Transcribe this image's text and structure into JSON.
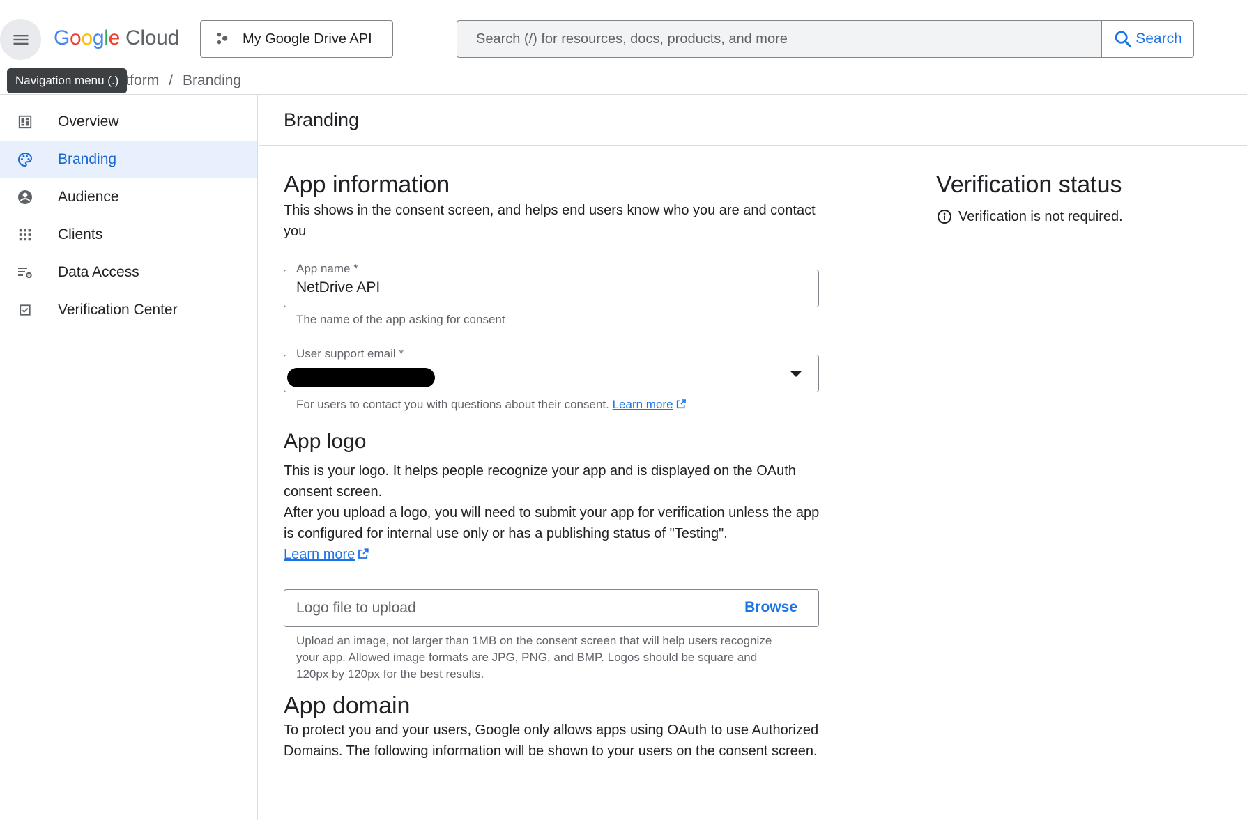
{
  "header": {
    "logo_google": [
      "G",
      "o",
      "o",
      "g",
      "l",
      "e"
    ],
    "logo_cloud": "Cloud",
    "project_name": "My Google Drive API",
    "search_placeholder": "Search (/) for resources, docs, products, and more",
    "search_button": "Search",
    "menu_tooltip": "Navigation menu (.)"
  },
  "breadcrumb": {
    "items": [
      "Platform",
      "Branding"
    ],
    "separator": "/"
  },
  "sidebar": {
    "items": [
      {
        "label": "Overview",
        "icon": "dashboard-icon",
        "active": false
      },
      {
        "label": "Branding",
        "icon": "palette-icon",
        "active": true
      },
      {
        "label": "Audience",
        "icon": "account-circle-icon",
        "active": false
      },
      {
        "label": "Clients",
        "icon": "apps-grid-icon",
        "active": false
      },
      {
        "label": "Data Access",
        "icon": "list-settings-icon",
        "active": false
      },
      {
        "label": "Verification Center",
        "icon": "checkbox-icon",
        "active": false
      }
    ]
  },
  "page": {
    "title": "Branding"
  },
  "app_information": {
    "title": "App information",
    "description": "This shows in the consent screen, and helps end users know who you are and contact you",
    "app_name_label": "App name *",
    "app_name_value": "NetDrive API",
    "app_name_hint": "The name of the app asking for consent",
    "support_email_label": "User support email *",
    "support_email_hint": "For users to contact you with questions about their consent.",
    "support_email_learn_more": "Learn more"
  },
  "app_logo": {
    "title": "App logo",
    "description_1": "This is your logo. It helps people recognize your app and is displayed on the OAuth consent screen.",
    "description_2": "After you upload a logo, you will need to submit your app for verification unless the app is configured for internal use only or has a publishing status of \"Testing\".",
    "learn_more": "Learn more",
    "upload_placeholder": "Logo file to upload",
    "browse_label": "Browse",
    "upload_hint": "Upload an image, not larger than 1MB on the consent screen that will help users recognize your app. Allowed image formats are JPG, PNG, and BMP. Logos should be square and 120px by 120px for the best results."
  },
  "app_domain": {
    "title": "App domain",
    "description": "To protect you and your users, Google only allows apps using OAuth to use Authorized Domains. The following information will be shown to your users on the consent screen."
  },
  "verification_status": {
    "title": "Verification status",
    "message": "Verification is not required.",
    "icon": "info-icon"
  },
  "colors": {
    "accent": "#1a73e8",
    "active_bg": "#e8f0fe",
    "border": "#dadce0"
  }
}
